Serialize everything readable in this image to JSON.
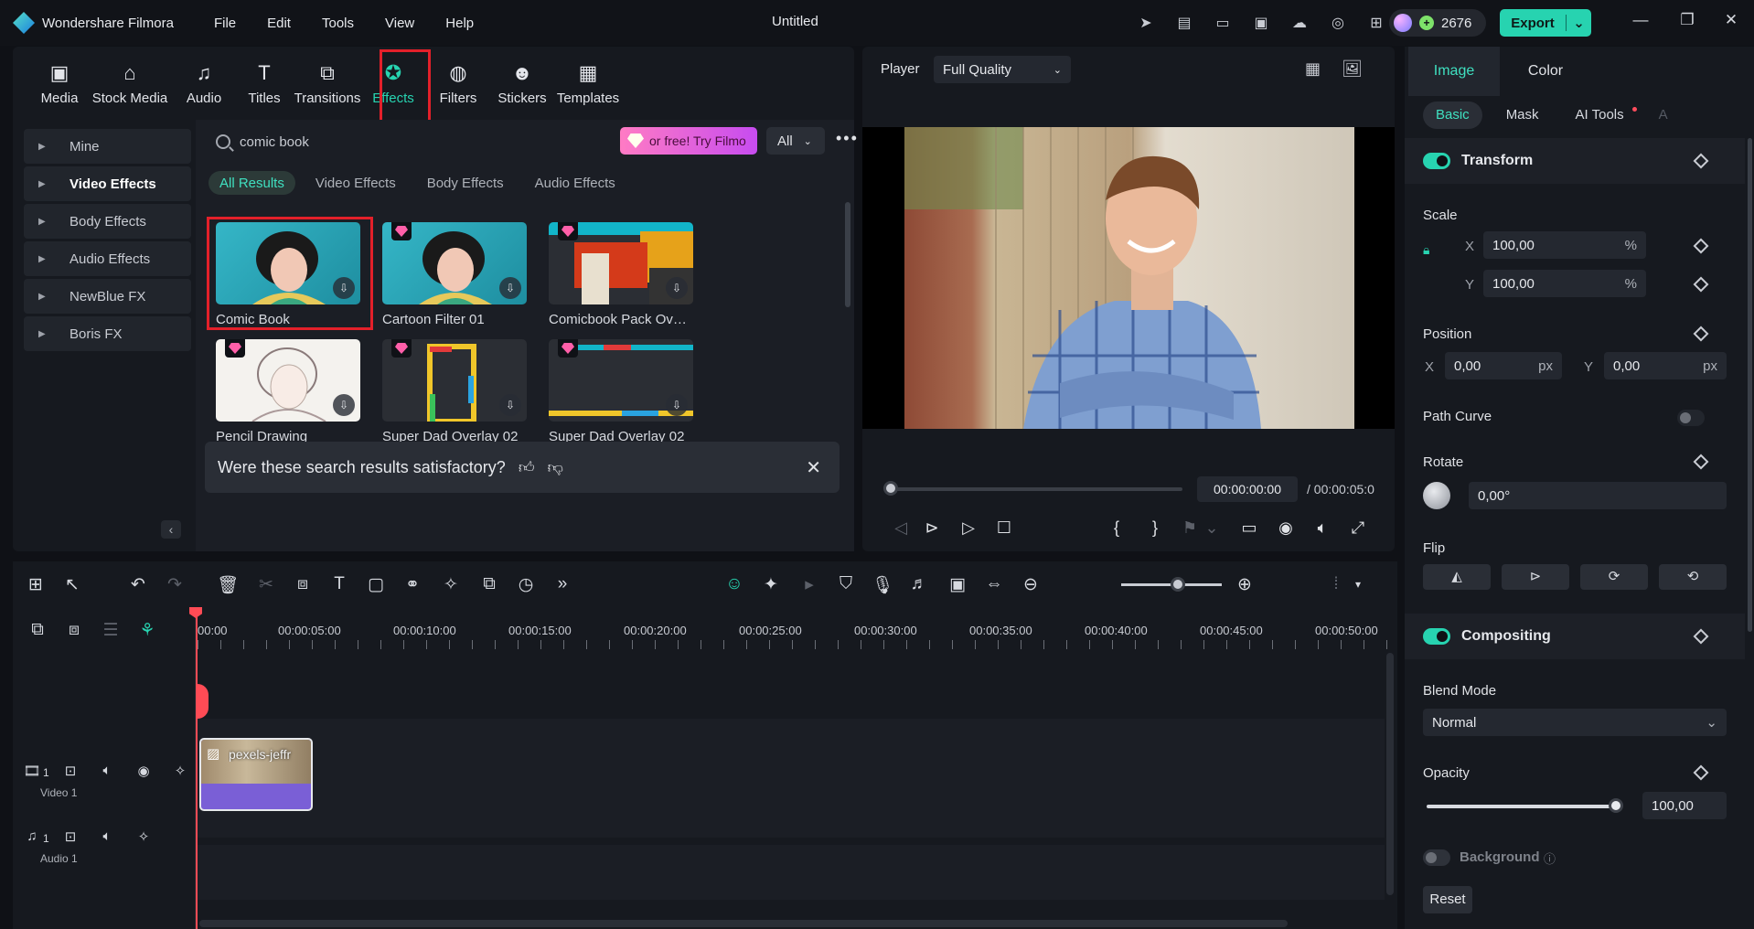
{
  "app": {
    "name": "Wondershare Filmora",
    "menu": [
      "File",
      "Edit",
      "Tools",
      "View",
      "Help"
    ],
    "document_title": "Untitled",
    "credits": "2676",
    "export_label": "Export"
  },
  "media_tabs": [
    {
      "label": "Media",
      "icon": "media-icon"
    },
    {
      "label": "Stock Media",
      "icon": "stock-media-icon"
    },
    {
      "label": "Audio",
      "icon": "music-note-icon"
    },
    {
      "label": "Titles",
      "icon": "text-icon"
    },
    {
      "label": "Transitions",
      "icon": "transitions-icon"
    },
    {
      "label": "Effects",
      "icon": "effects-star-icon",
      "active": true
    },
    {
      "label": "Filters",
      "icon": "filters-icon"
    },
    {
      "label": "Stickers",
      "icon": "stickers-icon"
    },
    {
      "label": "Templates",
      "icon": "templates-icon"
    }
  ],
  "sidebar": {
    "items": [
      {
        "label": "Mine"
      },
      {
        "label": "Video Effects",
        "bold": true
      },
      {
        "label": "Body Effects"
      },
      {
        "label": "Audio Effects"
      },
      {
        "label": "NewBlue FX"
      },
      {
        "label": "Boris FX"
      }
    ]
  },
  "search": {
    "query": "comic book",
    "promo_text": "or free! Try Filmo",
    "filter_value": "All"
  },
  "result_chips": [
    {
      "label": "All Results",
      "active": true
    },
    {
      "label": "Video Effects"
    },
    {
      "label": "Body Effects"
    },
    {
      "label": "Audio Effects"
    }
  ],
  "results": [
    {
      "label": "Comic Book",
      "premium": false,
      "highlighted": true
    },
    {
      "label": "Cartoon Filter 01",
      "premium": true
    },
    {
      "label": "Comicbook Pack Overl...",
      "premium": true
    },
    {
      "label": "Pencil Drawing",
      "premium": true
    },
    {
      "label": "Super Dad Overlay 02",
      "premium": true
    },
    {
      "label": "Super Dad Overlay 02",
      "premium": true
    },
    {
      "label": "",
      "premium": true
    },
    {
      "label": "",
      "premium": true
    },
    {
      "label": "",
      "premium": true
    }
  ],
  "feedback": {
    "question": "Were these search results satisfactory?"
  },
  "player": {
    "label": "Player",
    "quality": "Full Quality",
    "timecode": "00:00:00:00",
    "total": "/   00:00:05:0"
  },
  "inspector": {
    "tabs": [
      "Image",
      "Color"
    ],
    "subtabs": [
      "Basic",
      "Mask",
      "AI Tools",
      "A"
    ],
    "transform": {
      "title": "Transform",
      "scale_label": "Scale",
      "scale_x": "100,00",
      "scale_y": "100,00",
      "percent": "%",
      "position_label": "Position",
      "pos_x": "0,00",
      "pos_y": "0,00",
      "px": "px",
      "path_curve_label": "Path Curve",
      "rotate_label": "Rotate",
      "rotate_value": "0,00°",
      "flip_label": "Flip",
      "axis_x": "X",
      "axis_y": "Y"
    },
    "compositing": {
      "title": "Compositing",
      "blend_label": "Blend Mode",
      "blend_value": "Normal",
      "opacity_label": "Opacity",
      "opacity_value": "100,00",
      "opacity_level": 1.0
    },
    "background_label": "Background",
    "reset_label": "Reset"
  },
  "timeline": {
    "ruler": [
      "00:00",
      "00:00:05:00",
      "00:00:10:00",
      "00:00:15:00",
      "00:00:20:00",
      "00:00:25:00",
      "00:00:30:00",
      "00:00:35:00",
      "00:00:40:00",
      "00:00:45:00",
      "00:00:50:00"
    ],
    "video_track_name": "Video 1",
    "audio_track_name": "Audio 1",
    "track_number": "1",
    "clip_name": "pexels-jeffr"
  },
  "colors": {
    "accent": "#27d3b0",
    "highlight": "#e3202a",
    "playhead": "#ff4b55"
  }
}
